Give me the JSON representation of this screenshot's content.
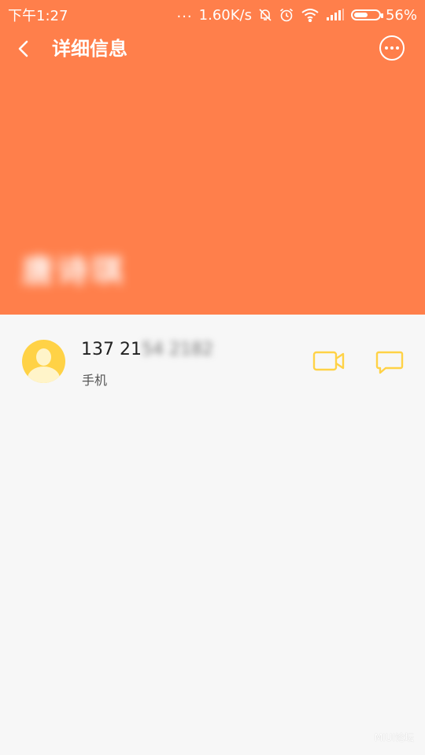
{
  "status_bar": {
    "time": "下午1:27",
    "dots": "...",
    "network_speed": "1.60K/s",
    "battery_percent": "56%",
    "battery_level": 0.56,
    "icons": [
      "bell-off-icon",
      "alarm-icon",
      "wifi-icon",
      "signal-icon",
      "battery-icon"
    ]
  },
  "title_bar": {
    "back_icon": "chevron-left-icon",
    "title": "详细信息",
    "more_icon": "more-horizontal-icon"
  },
  "contact": {
    "name": "唐诗琪"
  },
  "phone_entry": {
    "number_visible": "137 21",
    "number_masked": "54 2182",
    "type": "手机",
    "avatar_icon": "person-avatar-icon",
    "video_icon": "video-call-icon",
    "message_icon": "message-bubble-icon"
  },
  "watermark": "MIUI论坛",
  "colors": {
    "header": "#ff7f4b",
    "background": "#f7f7f7",
    "accent": "#ffd246"
  }
}
